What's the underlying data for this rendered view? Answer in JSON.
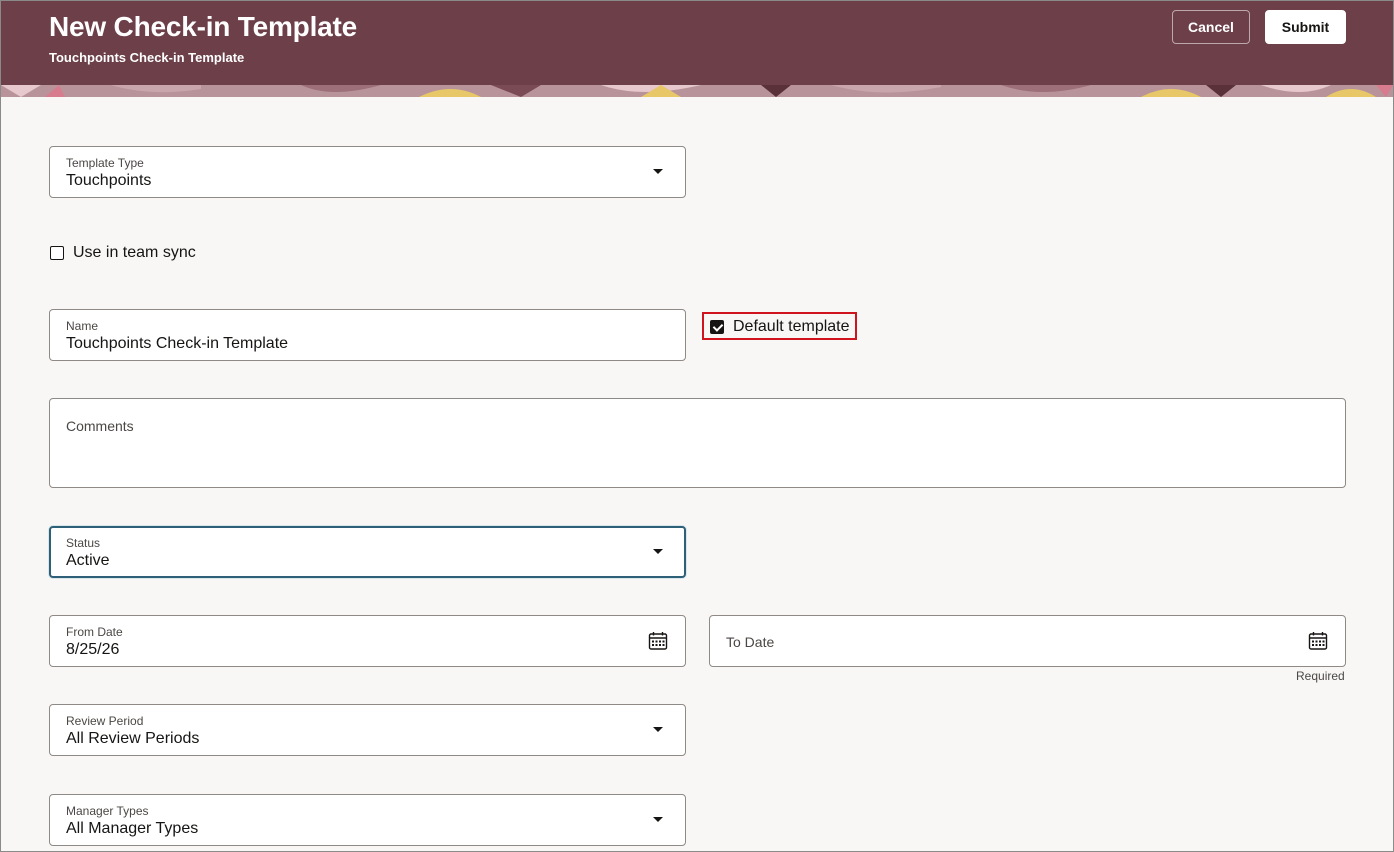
{
  "header": {
    "title": "New Check-in Template",
    "subtitle": "Touchpoints Check-in Template",
    "cancel_label": "Cancel",
    "submit_label": "Submit",
    "colors": {
      "banner": "#6c3f49",
      "accent_pink": "#d77b8e",
      "accent_yellow": "#e7c767"
    }
  },
  "form": {
    "template_type": {
      "label": "Template Type",
      "value": "Touchpoints"
    },
    "use_in_team_sync": {
      "label": "Use in team sync",
      "checked": false
    },
    "name": {
      "label": "Name",
      "value": "Touchpoints Check-in Template"
    },
    "default_template": {
      "label": "Default template",
      "checked": true
    },
    "comments": {
      "label": "Comments",
      "value": ""
    },
    "status": {
      "label": "Status",
      "value": "Active"
    },
    "from_date": {
      "label": "From Date",
      "value": "8/25/26",
      "icon": "calendar-icon"
    },
    "to_date": {
      "label": "To Date",
      "value": "",
      "icon": "calendar-icon",
      "helper": "Required"
    },
    "review_period": {
      "label": "Review Period",
      "value": "All Review Periods"
    },
    "manager_types": {
      "label": "Manager Types",
      "value": "All Manager Types"
    }
  }
}
